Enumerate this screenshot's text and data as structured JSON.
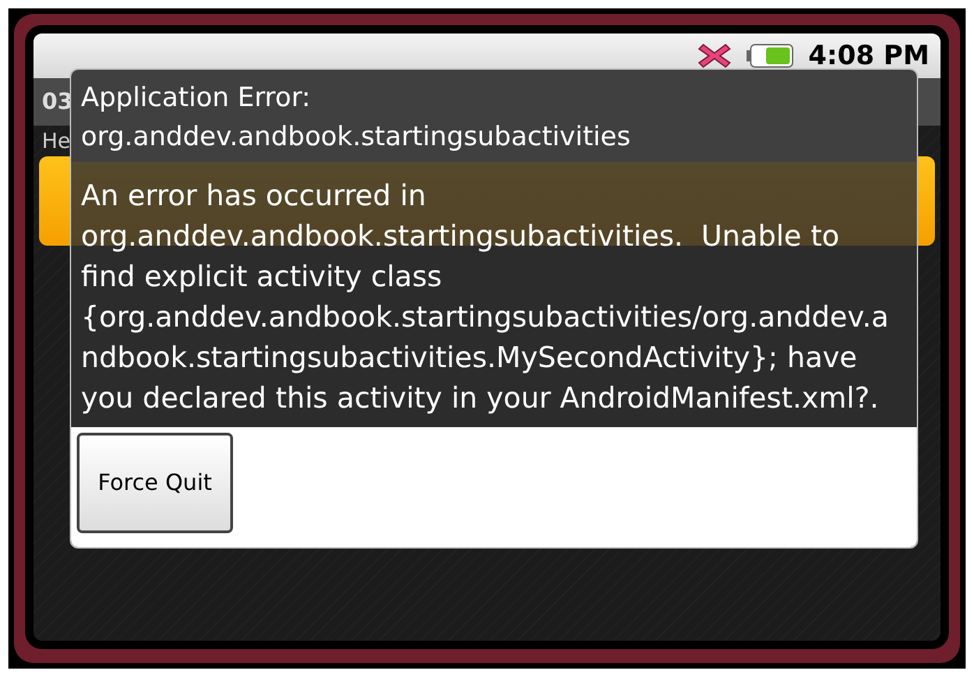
{
  "status_bar": {
    "time": "4:08 PM"
  },
  "background_app": {
    "title": "03",
    "text": "He"
  },
  "dialog": {
    "title": "Application Error:",
    "subtitle": "org.anddev.andbook.startingsubactivities",
    "message": "An error has occurred in org.anddev.andbook.startingsubactivities.  Unable to find explicit activity class {org.anddev.andbook.startingsubactivities/org.anddev.andbook.startingsubactivities.MySecondActivity}; have you declared this activity in your AndroidManifest.xml?.",
    "buttons": [
      "Force Quit"
    ]
  }
}
